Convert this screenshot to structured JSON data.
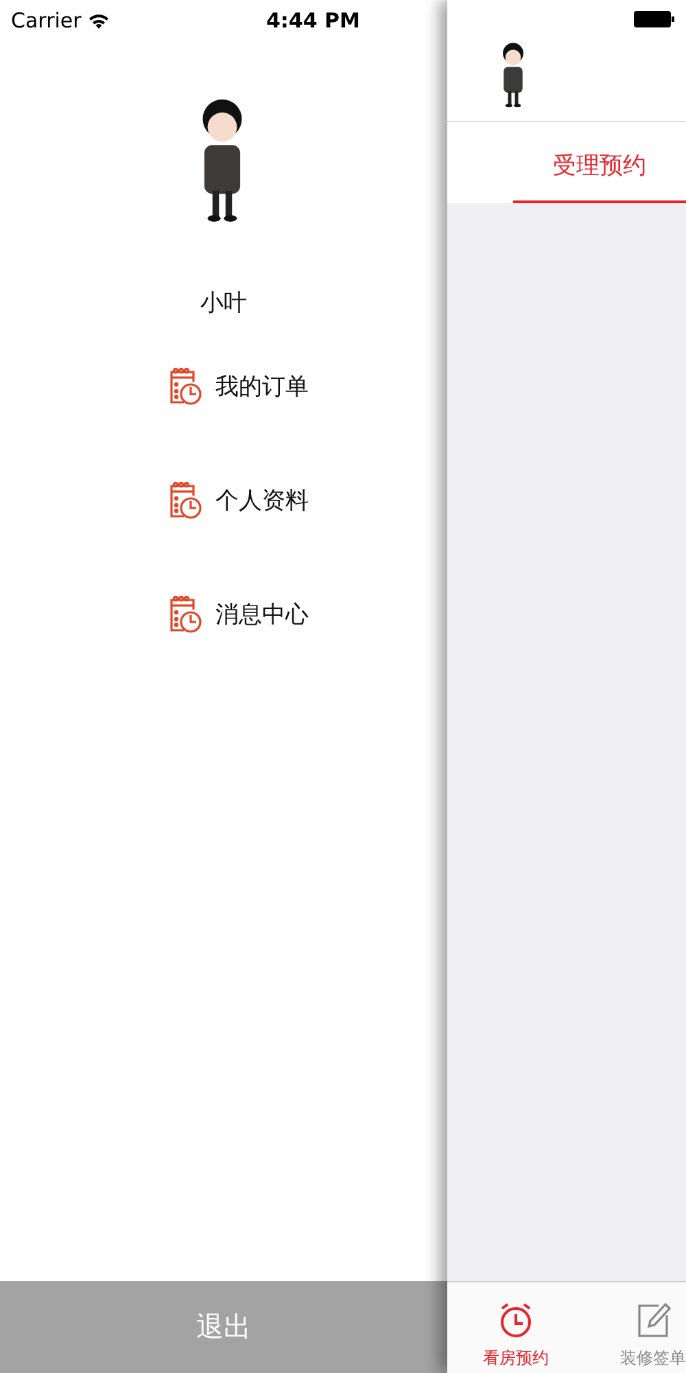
{
  "status_bar": {
    "carrier": "Carrier",
    "time": "4:44 PM"
  },
  "drawer": {
    "username": "小叶",
    "menu": [
      {
        "label": "我的订单"
      },
      {
        "label": "个人资料"
      },
      {
        "label": "消息中心"
      }
    ],
    "logout": "退出"
  },
  "main": {
    "segments": [
      {
        "label": "受理预约",
        "selected": true
      }
    ],
    "tab_bar": [
      {
        "label": "看房预约",
        "selected": true
      },
      {
        "label": "装修签单",
        "selected": false
      }
    ]
  }
}
